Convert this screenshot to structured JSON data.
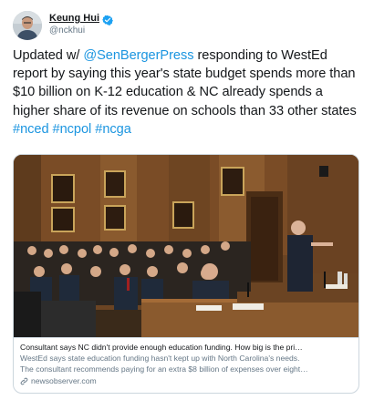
{
  "author": {
    "display_name": "Keung Hui",
    "handle": "@nckhui",
    "verified_icon": "verified-badge-icon",
    "verified_color": "#1da1f2"
  },
  "tweet": {
    "segments": [
      {
        "text": "Updated w/ ",
        "type": "text"
      },
      {
        "text": "@SenBergerPress",
        "type": "mention"
      },
      {
        "text": " responding to WestEd report by saying this year's state budget spends more than $10 billion on K-12 education & NC already spends a higher share of its revenue on schools than 33 other states ",
        "type": "text"
      },
      {
        "text": "#nced",
        "type": "hashtag"
      },
      {
        "text": " ",
        "type": "text"
      },
      {
        "text": "#ncpol",
        "type": "hashtag"
      },
      {
        "text": " ",
        "type": "text"
      },
      {
        "text": "#ncga",
        "type": "hashtag"
      }
    ],
    "link_color": "#1b95e0"
  },
  "card": {
    "image_alt": "photo-of-legislative-hearing-room",
    "title": "Consultant says NC didn't provide enough education funding. How big is the pri…",
    "description_lines": [
      "WestEd says state education funding hasn't kept up with North Carolina's needs.",
      "The consultant recommends paying for an extra $8 billion of expenses over eight…"
    ],
    "domain": "newsobserver.com",
    "domain_icon": "link-icon"
  }
}
